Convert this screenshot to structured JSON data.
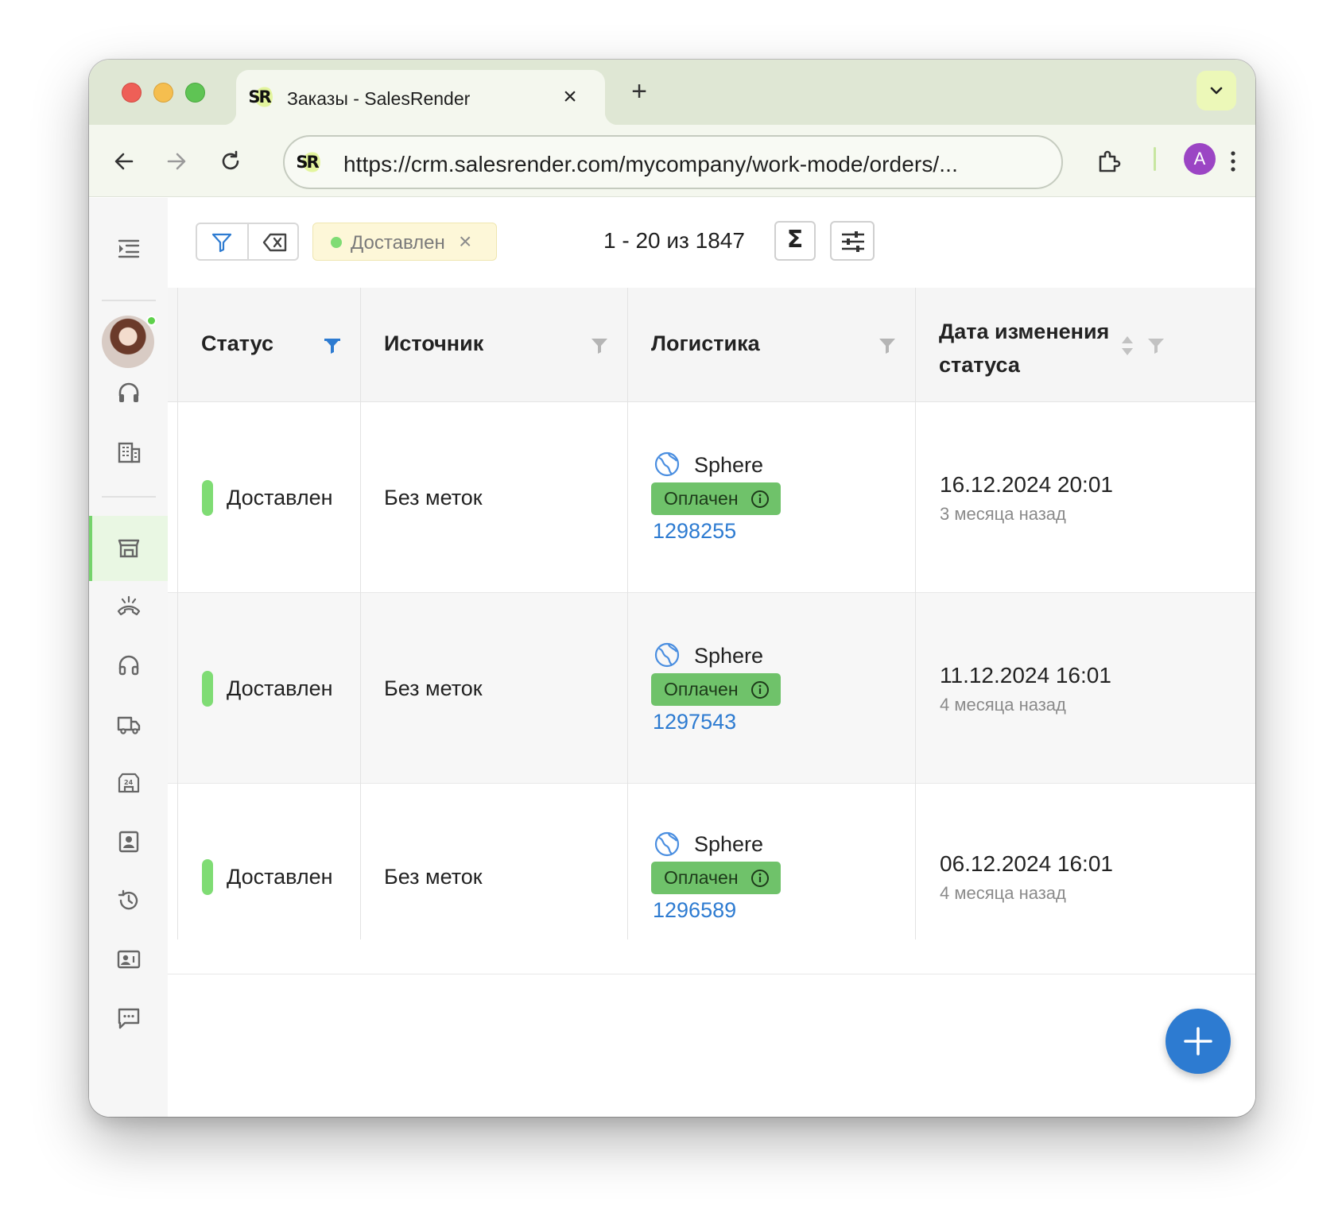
{
  "browser": {
    "tab_title": "Заказы - SalesRender",
    "tab_logo": "SR",
    "url": "https://crm.salesrender.com/mycompany/work-mode/orders/...",
    "profile_initial": "A",
    "icons": [
      "close-icon",
      "plus-icon",
      "chevron-down-icon",
      "back-icon",
      "forward-icon",
      "reload-icon",
      "extension-icon",
      "kebab-menu-icon"
    ]
  },
  "toolbar": {
    "filter_chip": "Доставлен",
    "pager": "1 - 20 из 1847",
    "sigma": "Σ"
  },
  "table": {
    "columns": [
      "Статус",
      "Источник",
      "Логистика",
      "Дата изменения статуса"
    ],
    "rows": [
      {
        "status": "Доставлен",
        "source": "Без меток",
        "logistics": "Sphere",
        "payment": "Оплачен",
        "order": "1298255",
        "date": "16.12.2024 20:01",
        "ago": "3 месяца назад"
      },
      {
        "status": "Доставлен",
        "source": "Без меток",
        "logistics": "Sphere",
        "payment": "Оплачен",
        "order": "1297543",
        "date": "11.12.2024 16:01",
        "ago": "4 месяца назад"
      },
      {
        "status": "Доставлен",
        "source": "Без меток",
        "logistics": "Sphere",
        "payment": "Оплачен",
        "order": "1296589",
        "date": "06.12.2024 16:01",
        "ago": "4 месяца назад"
      }
    ]
  },
  "colors": {
    "status_green": "#7fdc74",
    "paid_badge": "#6fc26a",
    "link_blue": "#2d7bd1",
    "fab_blue": "#2d7bd1"
  }
}
